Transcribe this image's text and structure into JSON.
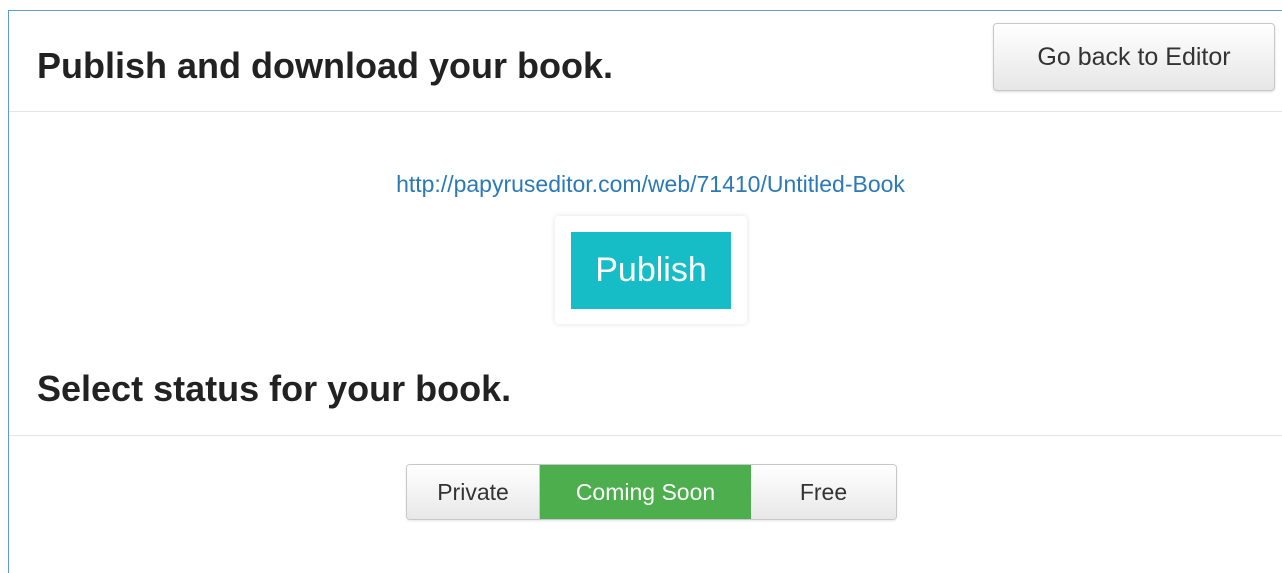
{
  "header": {
    "title": "Publish and download your book.",
    "back_label": "Go back to Editor"
  },
  "publish": {
    "url": "http://papyruseditor.com/web/71410/Untitled-Book",
    "button_label": "Publish",
    "button_color": "#17bdc6"
  },
  "status": {
    "title": "Select status for your book.",
    "options": [
      {
        "label": "Private",
        "selected": false
      },
      {
        "label": "Coming Soon",
        "selected": true
      },
      {
        "label": "Free",
        "selected": false
      }
    ],
    "selected_color": "#4cae4c"
  },
  "colors": {
    "link": "#2a7ab8",
    "frame_border": "#5b9bd5"
  }
}
